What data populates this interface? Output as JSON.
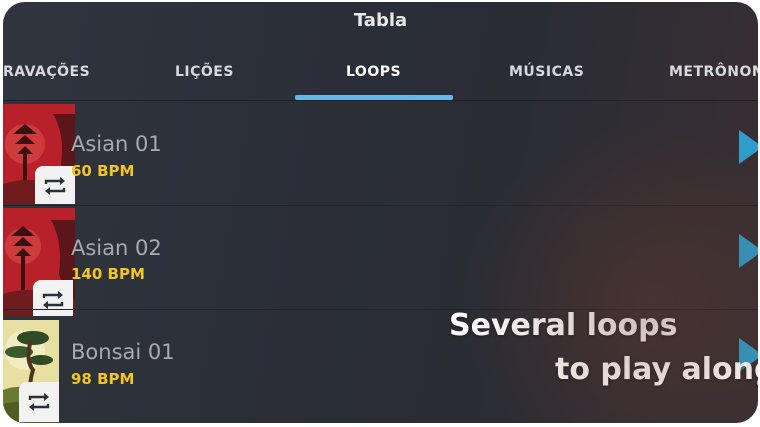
{
  "header": {
    "title": "Tabla"
  },
  "tabs": [
    {
      "label": "GRAVAÇÕES"
    },
    {
      "label": "LIÇÕES"
    },
    {
      "label": "LOOPS"
    },
    {
      "label": "MÚSICAS"
    },
    {
      "label": "METRÔNOMO"
    }
  ],
  "active_tab": "LOOPS",
  "loops": [
    {
      "name": "Asian 01",
      "bpm": "60 BPM"
    },
    {
      "name": "Asian 02",
      "bpm": "140 BPM"
    },
    {
      "name": "Bonsai 01",
      "bpm": "98 BPM"
    }
  ],
  "promo": {
    "line1": "Several loops",
    "line2": "to play along"
  },
  "colors": {
    "accent": "#66b6e6",
    "bpm": "#f2c61f",
    "play": "#2e9dc9"
  },
  "icons": {
    "loop": "repeat-icon",
    "play": "play-icon"
  }
}
